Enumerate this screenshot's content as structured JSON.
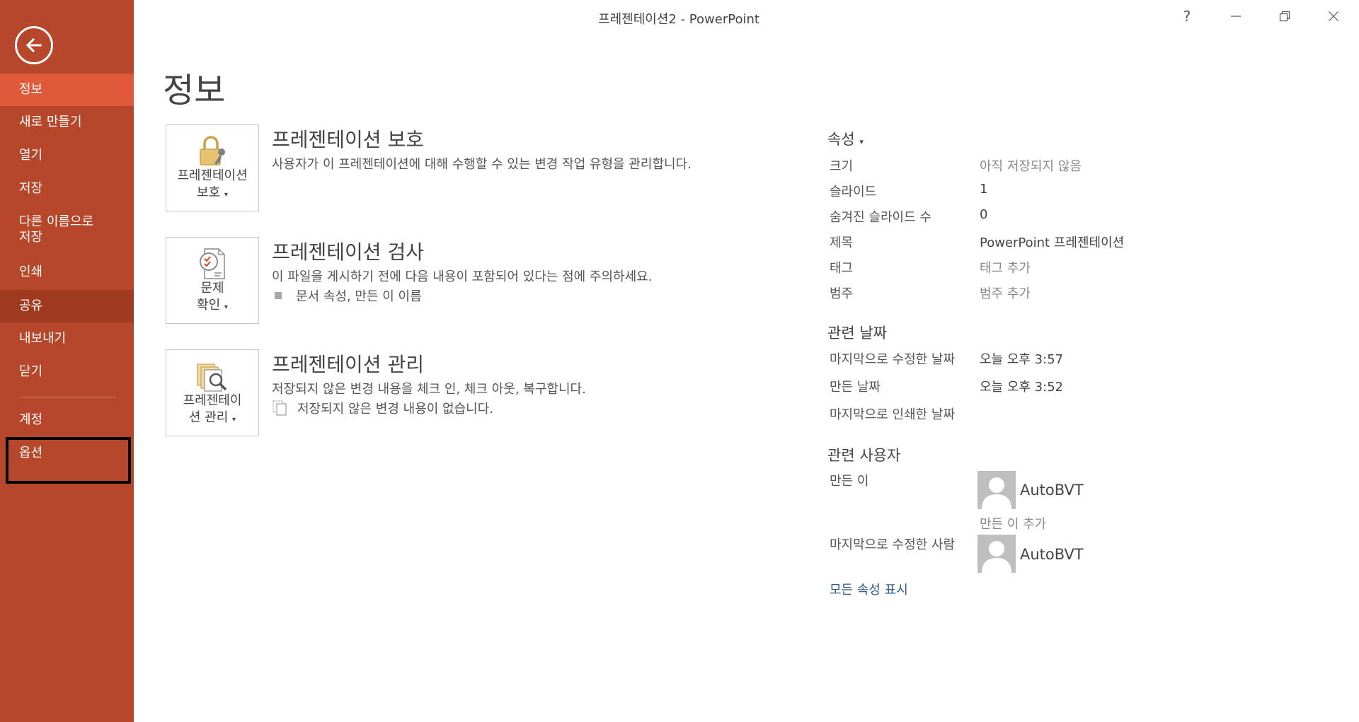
{
  "window": {
    "title": "프레젠테이션2 - PowerPoint",
    "help": "?",
    "minimize": "—",
    "close": "✕"
  },
  "sidebar": {
    "items": [
      {
        "label": "정보"
      },
      {
        "label": "새로 만들기"
      },
      {
        "label": "열기"
      },
      {
        "label": "저장"
      },
      {
        "label": "다른 이름으로 저장"
      },
      {
        "label": "인쇄"
      },
      {
        "label": "공유"
      },
      {
        "label": "내보내기"
      },
      {
        "label": "닫기"
      },
      {
        "label": "계정"
      },
      {
        "label": "옵션"
      }
    ]
  },
  "page": {
    "title": "정보"
  },
  "sections": {
    "protect": {
      "button_line1": "프레젠테이션",
      "button_line2": "보호",
      "title": "프레젠테이션 보호",
      "desc": "사용자가 이 프레젠테이션에 대해 수행할 수 있는 변경 작업 유형을 관리합니다."
    },
    "inspect": {
      "button_line1": "문제",
      "button_line2": "확인",
      "title": "프레젠테이션 검사",
      "desc": "이 파일을 게시하기 전에 다음 내용이 포함되어 있다는 점에 주의하세요.",
      "bullet": "문서 속성, 만든 이 이름"
    },
    "manage": {
      "button_line1": "프레젠테이",
      "button_line2": "션 관리",
      "title": "프레젠테이션 관리",
      "desc": "저장되지 않은 변경 내용을 체크 인, 체크 아웃, 복구합니다.",
      "bullet": "저장되지 않은 변경 내용이 없습니다."
    },
    "caret": "▾"
  },
  "properties": {
    "heading": "속성",
    "caret": "▾",
    "rows": [
      {
        "label": "크기",
        "value": "아직 저장되지 않음"
      },
      {
        "label": "슬라이드",
        "value": "1"
      },
      {
        "label": "숨겨진 슬라이드 수",
        "value": "0"
      },
      {
        "label": "제목",
        "value": "PowerPoint 프레젠테이션"
      },
      {
        "label": "태그",
        "value": "태그 추가"
      },
      {
        "label": "범주",
        "value": "범주 추가"
      }
    ]
  },
  "dates": {
    "heading": "관련 날짜",
    "rows": [
      {
        "label": "마지막으로 수정한 날짜",
        "value": "오늘 오후 3:57"
      },
      {
        "label": "만든 날짜",
        "value": "오늘 오후 3:52"
      },
      {
        "label": "마지막으로 인쇄한 날짜",
        "value": ""
      }
    ]
  },
  "people": {
    "heading": "관련 사용자",
    "author_label": "만든 이",
    "author_name": "AutoBVT",
    "add_author": "만든 이 추가",
    "last_modified_label": "마지막으로 수정한 사람",
    "last_modified_name": "AutoBVT"
  },
  "show_all": "모든 속성 표시",
  "colors": {
    "sidebar": "#b7472a",
    "active": "#e05a3a",
    "hover": "#9d3a20",
    "link": "#2e5c8a"
  }
}
